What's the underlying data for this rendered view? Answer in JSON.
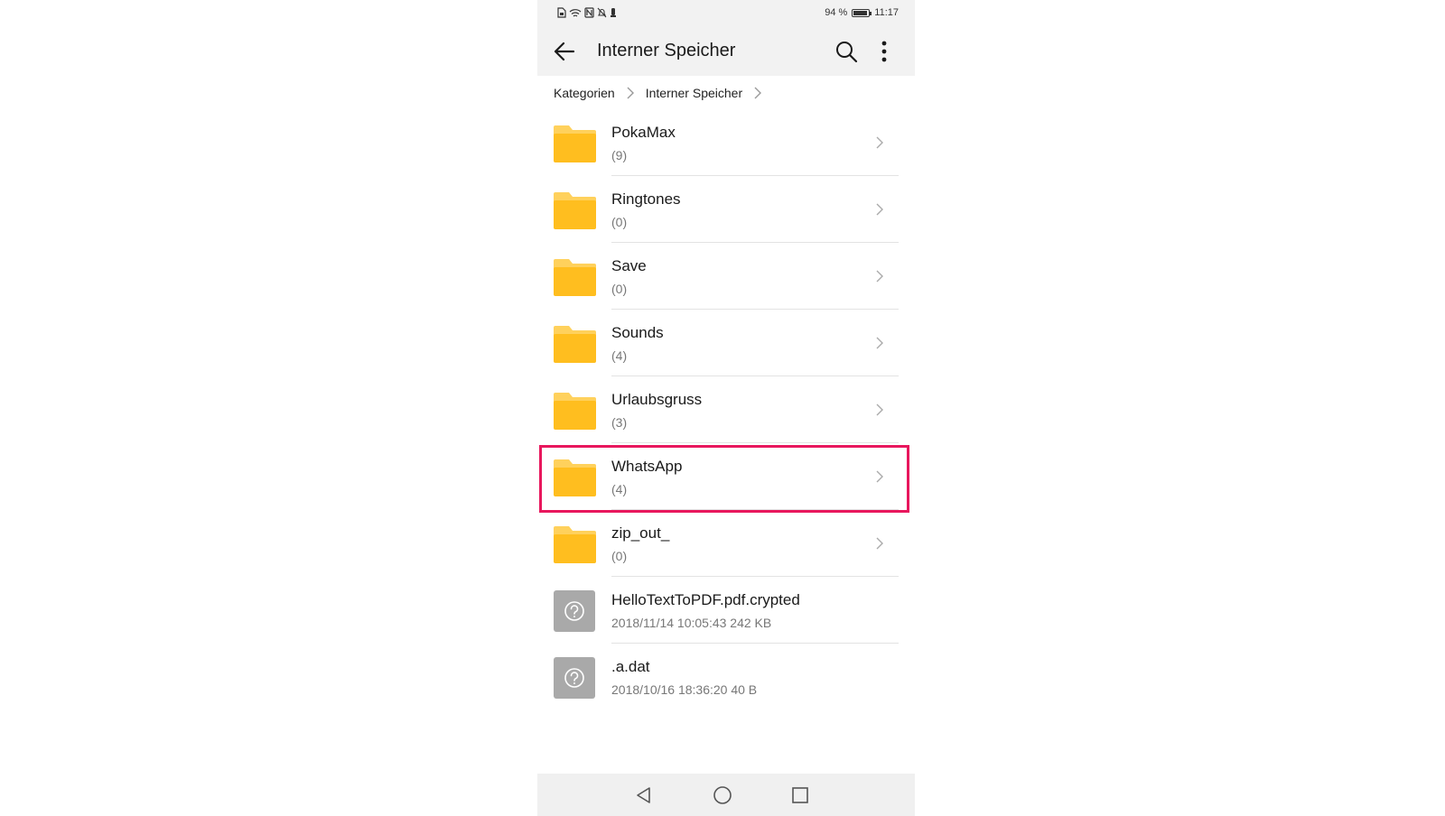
{
  "status_bar": {
    "battery_percent_text": "94 %",
    "battery_level": 0.94,
    "time": "11:17",
    "icons": [
      "sim-icon",
      "wifi-icon",
      "nfc-icon",
      "mute-icon",
      "notification-icon"
    ]
  },
  "app_bar": {
    "title": "Interner Speicher",
    "back_icon": "arrow-left-icon",
    "search_icon": "search-icon",
    "more_icon": "more-vertical-icon"
  },
  "breadcrumb": {
    "items": [
      "Kategorien",
      "Interner Speicher"
    ]
  },
  "colors": {
    "folder": "#FFBE1F",
    "folder_tab": "#FFD15C",
    "highlight": "#E8175D",
    "unknown_file": "#A9A9A9"
  },
  "files": [
    {
      "name": "PokaMax",
      "meta": "(9)",
      "type": "folder"
    },
    {
      "name": "Ringtones",
      "meta": "(0)",
      "type": "folder"
    },
    {
      "name": "Save",
      "meta": "(0)",
      "type": "folder"
    },
    {
      "name": "Sounds",
      "meta": "(4)",
      "type": "folder"
    },
    {
      "name": "Urlaubsgruss",
      "meta": "(3)",
      "type": "folder"
    },
    {
      "name": "WhatsApp",
      "meta": "(4)",
      "type": "folder",
      "highlighted": true
    },
    {
      "name": "zip_out_",
      "meta": "(0)",
      "type": "folder"
    },
    {
      "name": "HelloTextToPDF.pdf.crypted",
      "meta": "2018/11/14 10:05:43 242 KB",
      "type": "unknown"
    },
    {
      "name": ".a.dat",
      "meta": "2018/10/16 18:36:20 40 B",
      "type": "unknown"
    }
  ],
  "nav_bar": {
    "icons": [
      "back-triangle-icon",
      "home-circle-icon",
      "recents-square-icon"
    ]
  }
}
